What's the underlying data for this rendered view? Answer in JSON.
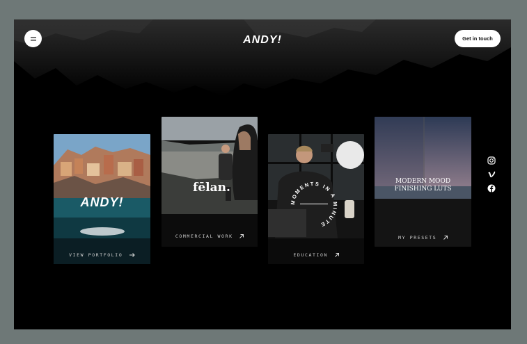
{
  "header": {
    "menu_icon": "menu-icon",
    "logo": "ANDY!",
    "cta_label": "Get in touch"
  },
  "cards": [
    {
      "overlay": "ANDY!",
      "label": "VIEW PORTFOLIO",
      "icon": "arrow-right-icon"
    },
    {
      "overlay": "fēlan.",
      "label": "COMMERCIAL WORK",
      "icon": "arrow-up-right-icon"
    },
    {
      "overlay_circle": "MOMENTS IN A MINUTE",
      "label": "EDUCATION",
      "icon": "arrow-up-right-icon"
    },
    {
      "overlay_line1": "MODERN MOOD",
      "overlay_line2": "FINISHING LUTS",
      "label": "MY PRESETS",
      "icon": "arrow-up-right-icon"
    }
  ],
  "socials": [
    "instagram-icon",
    "vimeo-icon",
    "facebook-icon"
  ],
  "colors": {
    "outer_bg": "#6e7877",
    "frame_bg": "#000000",
    "button_bg": "#ffffff"
  }
}
